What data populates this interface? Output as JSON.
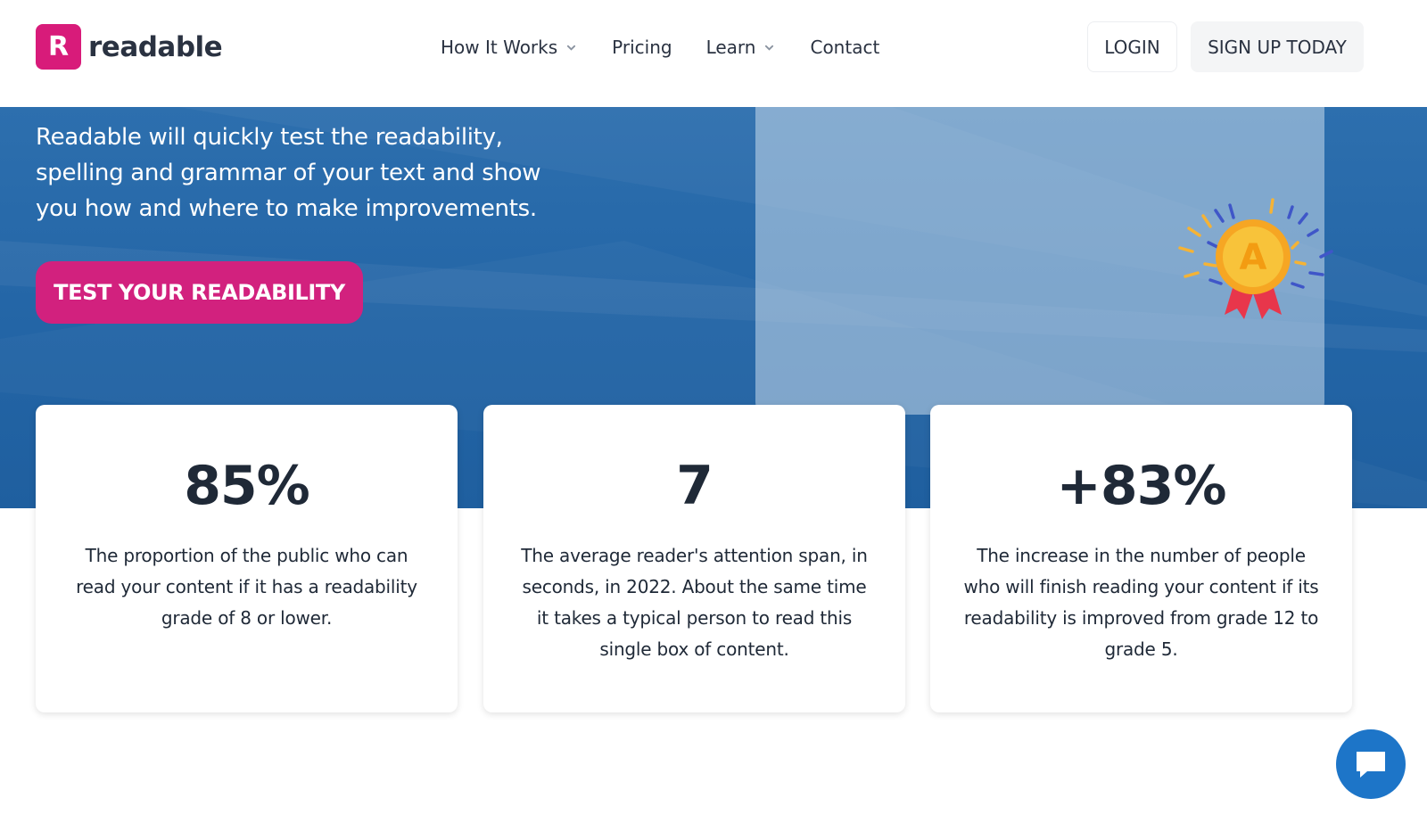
{
  "header": {
    "logo_letter": "R",
    "logo_text": "readable",
    "nav": [
      {
        "label": "How It Works",
        "has_dropdown": true
      },
      {
        "label": "Pricing",
        "has_dropdown": false
      },
      {
        "label": "Learn",
        "has_dropdown": true
      },
      {
        "label": "Contact",
        "has_dropdown": false
      }
    ],
    "login_label": "LOGIN",
    "signup_label": "SIGN UP TODAY"
  },
  "hero": {
    "text": "Readable will quickly test the readability, spelling and grammar of your text and show you how and where to make improvements.",
    "cta_label": "TEST YOUR READABILITY",
    "medal_letter": "A"
  },
  "stats": [
    {
      "value": "85%",
      "description": "The proportion of the public who can read your content if it has a readability grade of 8 or lower."
    },
    {
      "value": "7",
      "description": "The average reader's attention span, in seconds, in 2022. About the same time it takes a typical person to read this single box of content."
    },
    {
      "value": "+83%",
      "description": "The increase in the number of people who will finish reading your content if its readability is improved from grade 12 to grade 5."
    }
  ],
  "colors": {
    "brand_pink": "#d81b7a",
    "hero_blue": "#2365a6",
    "chat_blue": "#1d75c8",
    "text_dark": "#1f2937"
  },
  "icons": {
    "chevron": "chevron-down-icon",
    "chat": "chat-bubble-icon",
    "medal": "award-medal-icon"
  }
}
